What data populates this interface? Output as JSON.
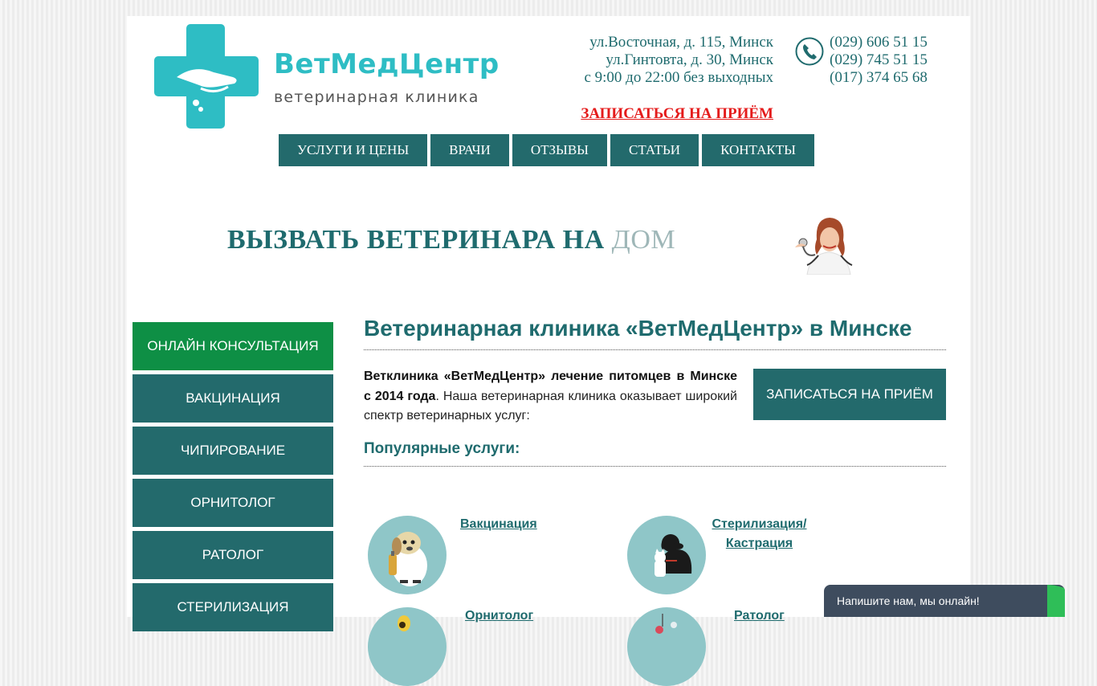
{
  "header": {
    "brand": "ВетМедЦентр",
    "tagline": "ветеринарная клиника",
    "address_lines": [
      "ул.Восточная, д. 115, Минск",
      "ул.Гинтовта, д. 30, Минск",
      "с 9:00 до 22:00 без выходных"
    ],
    "phones": [
      "(029) 606 51 15",
      "(029) 745 51 15",
      "(017) 374 65 68"
    ],
    "book_link": "ЗАПИСАТЬСЯ НА ПРИЁМ"
  },
  "nav": [
    "УСЛУГИ И ЦЕНЫ",
    "ВРАЧИ",
    "ОТЗЫВЫ",
    "СТАТЬИ",
    "КОНТАКТЫ"
  ],
  "banner": {
    "text_main": "ВЫЗВАТЬ ВЕТЕРИНАРА НА",
    "text_accent": "ДОМ"
  },
  "sidebar": [
    "ОНЛАЙН КОНСУЛЬТАЦИЯ",
    "ВАКЦИНАЦИЯ",
    "ЧИПИРОВАНИЕ",
    "ОРНИТОЛОГ",
    "РАТОЛОГ",
    "СТЕРИЛИЗАЦИЯ"
  ],
  "main": {
    "title": "Ветеринарная клиника «ВетМедЦентр» в Минске",
    "intro_bold": "Ветклиника «ВетМедЦентр» лечение питомцев в Минске с 2014 года",
    "intro_rest": ". Наша ветеринарная клиника оказывает широкий спектр ветеринарных услуг:",
    "cta": "ЗАПИСАТЬСЯ НА ПРИЁМ",
    "popular_title": "Популярные услуги:",
    "services": [
      "Вакцинация",
      "Стерилизация/",
      "Кастрация",
      "Орнитолог",
      "Ратолог"
    ]
  },
  "chat": {
    "text": "Напишите нам, мы онлайн!"
  },
  "colors": {
    "primary": "#236a6c",
    "active": "#0e8f45",
    "accent_red": "#e41b1b",
    "brand_teal": "#2ebdc4"
  }
}
